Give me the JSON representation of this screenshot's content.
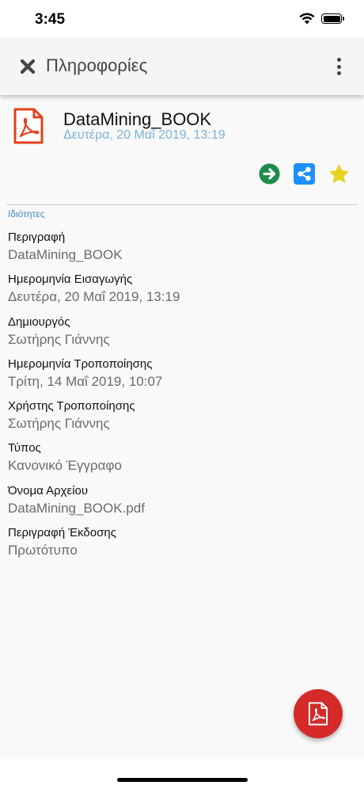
{
  "status_bar": {
    "time": "3:45"
  },
  "app_bar": {
    "title": "Πληροφορίες",
    "close_icon": "close-icon",
    "more_icon": "more-vert-icon"
  },
  "document": {
    "icon": "pdf-file-icon",
    "title": "DataMining_BOOK",
    "date": "Δευτέρα, 20 Μαΐ 2019, 13:19"
  },
  "actions": [
    {
      "name": "open-arrow-icon",
      "color": "#1e8a4c"
    },
    {
      "name": "share-icon",
      "color": "#1e90ff"
    },
    {
      "name": "star-icon",
      "color": "#e8d21a"
    }
  ],
  "section_label": "Ιδιότητες",
  "properties": [
    {
      "label": "Περιγραφή",
      "value": "DataMining_BOOK"
    },
    {
      "label": "Ημερομηνία Εισαγωγής",
      "value": "Δευτέρα, 20 Μαΐ 2019, 13:19"
    },
    {
      "label": "Δημιουργός",
      "value": "Σωτήρης Γιάννης"
    },
    {
      "label": "Ημερομηνία Τροποποίησης",
      "value": "Τρίτη, 14 Μαΐ 2019, 10:07"
    },
    {
      "label": "Χρήστης Τροποποίησης",
      "value": "Σωτήρης Γιάννης"
    },
    {
      "label": "Τύπος",
      "value": "Κανονικό Έγγραφο"
    },
    {
      "label": "Όνομα Αρχείου",
      "value": "DataMining_BOOK.pdf"
    },
    {
      "label": "Περιγραφή Έκδοσης",
      "value": "Πρωτότυπο"
    }
  ],
  "fab": {
    "icon": "pdf-icon",
    "color": "#d42a2a"
  },
  "colors": {
    "accent": "#3d8ccf",
    "date": "#7ab2d8",
    "pdf_red": "#e2401c"
  }
}
